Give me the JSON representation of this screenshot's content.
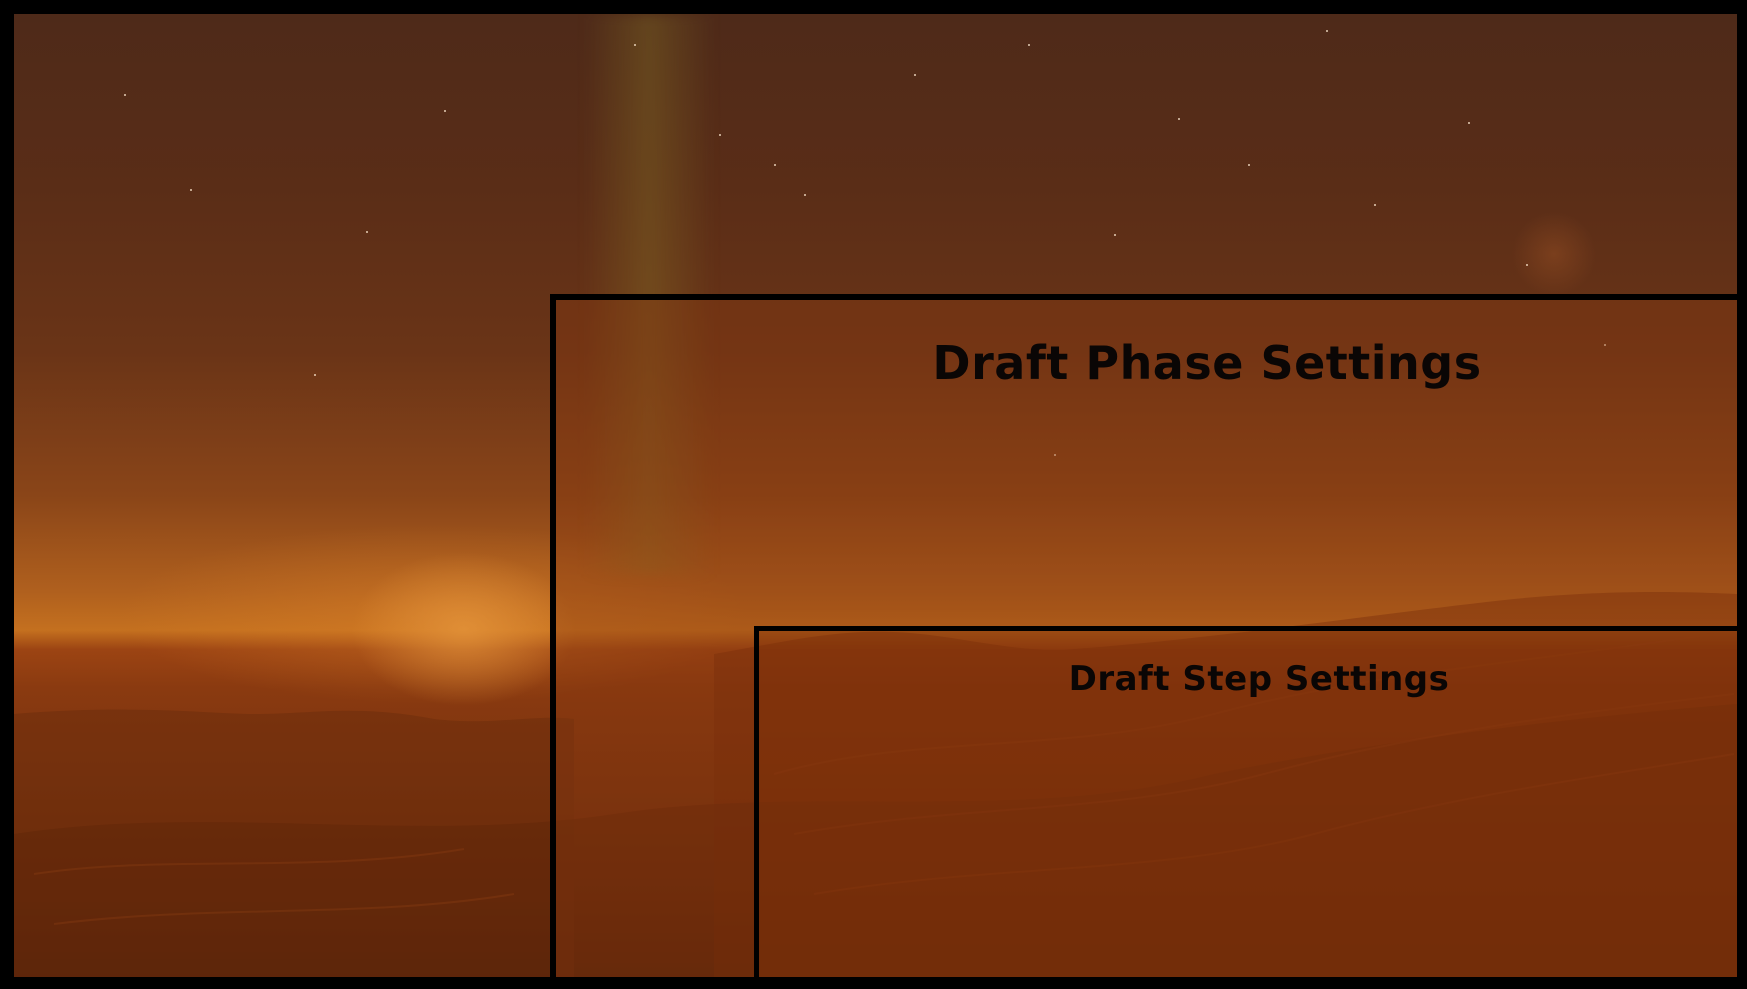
{
  "screen": {
    "name": "game-settings-layout",
    "background_scene": "desert-planet-sunset",
    "accent_colors": {
      "sky_top": "#4e2a19",
      "horizon_glow": "#c4701f",
      "ground": "#7a330e",
      "panel_border": "#000000",
      "title_text": "#0a0605"
    }
  },
  "panels": {
    "phase": {
      "title": "Draft Phase Settings"
    },
    "step": {
      "title": "Draft Step Settings"
    }
  }
}
